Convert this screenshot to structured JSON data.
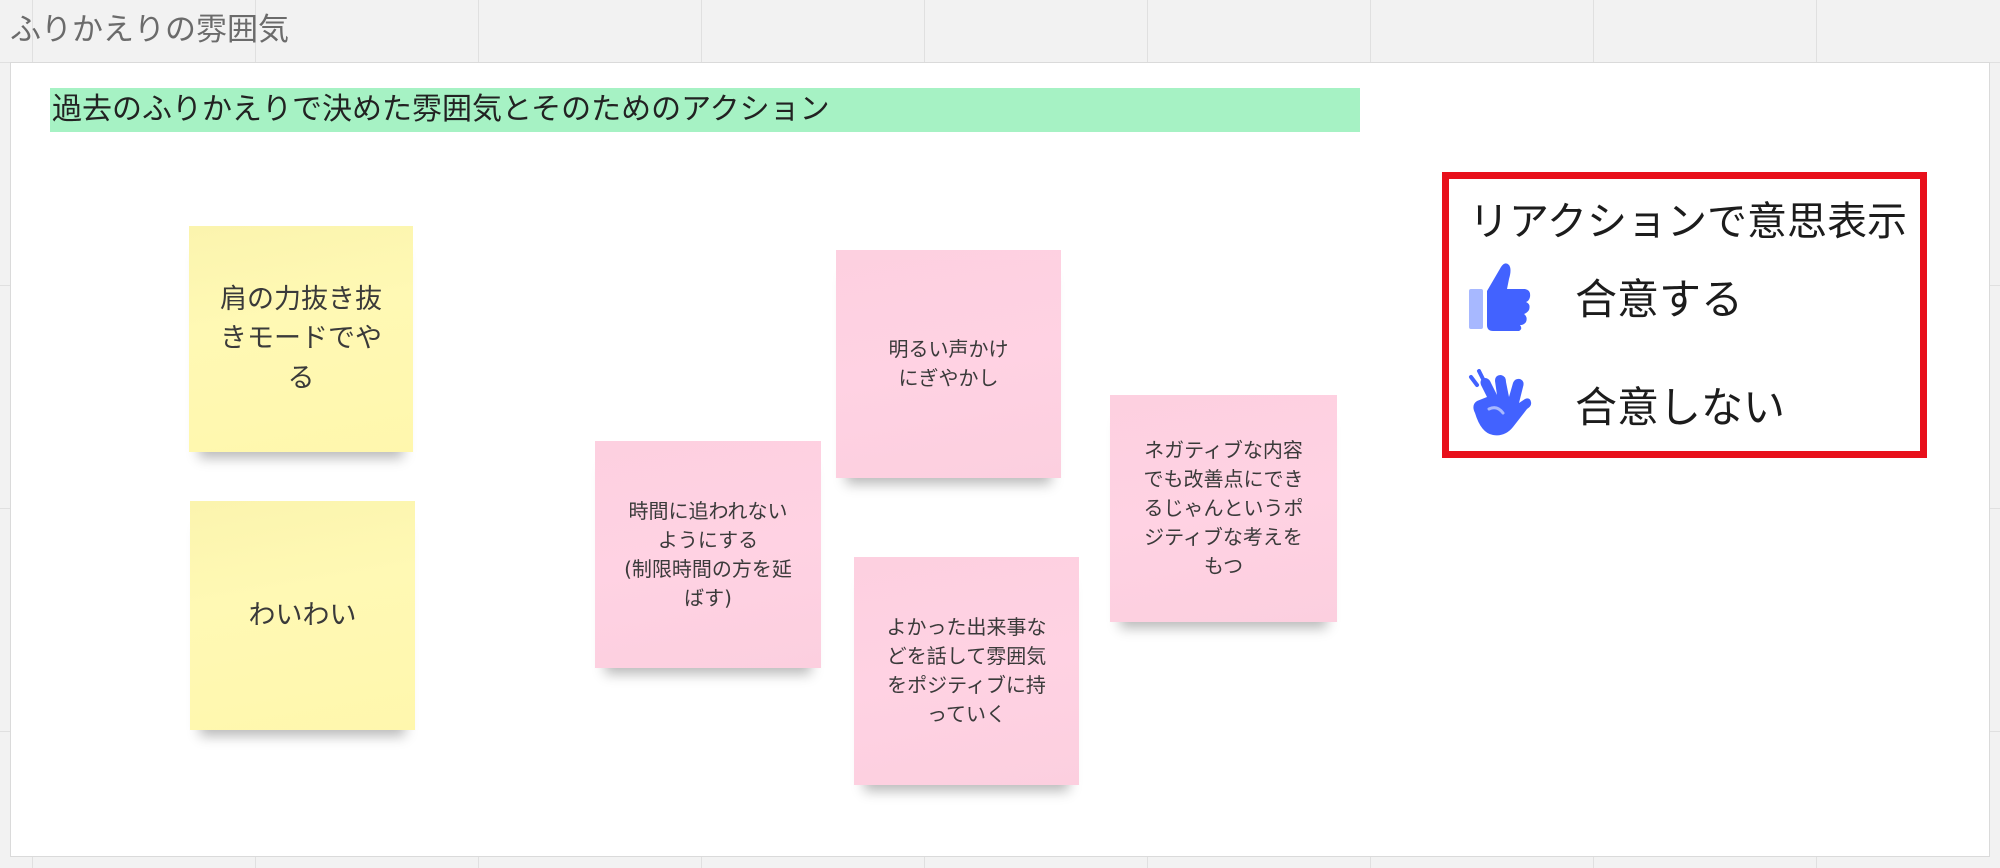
{
  "frame": {
    "title": "ふりかえりの雰囲気"
  },
  "heading": "過去のふりかえりで決めた雰囲気とそのためのアクション",
  "stickies": {
    "yellow_1": "肩の力抜き抜\nきモードでや\nる",
    "yellow_2": "わいわい",
    "pink_1": "明るい声かけ\nにぎやかし",
    "pink_2": "時間に追われない\nようにする\n(制限時間の方を延\nばす)",
    "pink_3": "よかった出来事な\nどを話して雰囲気\nをポジティブに持\nっていく",
    "pink_4": "ネガティブな内容\nでも改善点にでき\nるじゃんというポ\nジティブな考えを\nもつ"
  },
  "reactions": {
    "title": "リアクションで意思表示",
    "agree": {
      "label": "合意する",
      "icon": "thumbs-up-icon"
    },
    "disagree": {
      "label": "合意しない",
      "icon": "waving-hand-icon"
    }
  },
  "colors": {
    "heading_bg": "#a6f2c4",
    "sticky_yellow": "#fff9b4",
    "sticky_pink": "#ffd2e3",
    "reaction_border": "#e8101b",
    "icon_blue": "#4262ff"
  }
}
